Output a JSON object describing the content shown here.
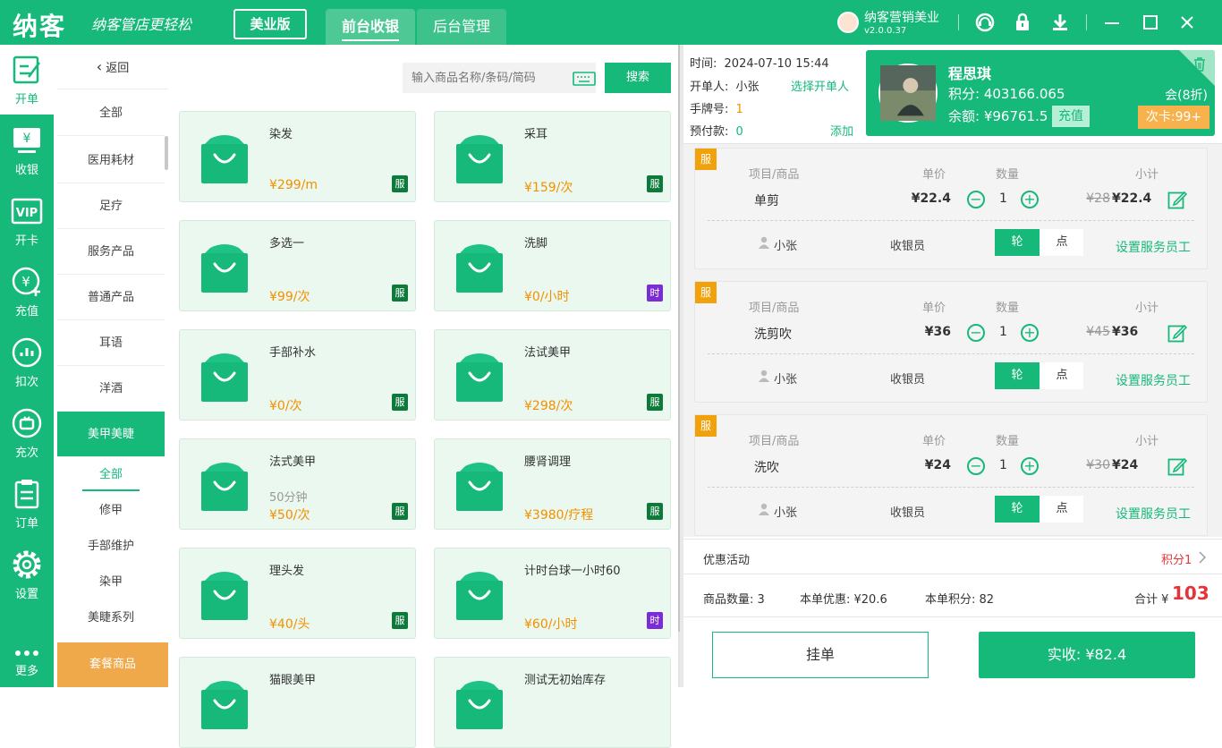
{
  "topbar": {
    "logo": "纳客",
    "slogan": "纳客管店更轻松",
    "edition": "美业版",
    "tabs": [
      {
        "label": "前台收银"
      },
      {
        "label": "后台管理"
      }
    ],
    "store_name": "纳客营销美业",
    "version": "v2.0.0.37"
  },
  "rail": [
    {
      "label": "开单",
      "icon": "edit-bill-icon"
    },
    {
      "label": "收银",
      "icon": "cashier-monitor-icon"
    },
    {
      "label": "开卡",
      "icon": "vip-card-icon"
    },
    {
      "label": "充值",
      "icon": "yen-plus-icon"
    },
    {
      "label": "扣次",
      "icon": "chart-circle-icon"
    },
    {
      "label": "充次",
      "icon": "timer-circle-icon"
    },
    {
      "label": "订单",
      "icon": "clipboard-icon"
    },
    {
      "label": "设置",
      "icon": "gear-icon"
    },
    {
      "label": "更多",
      "icon": "more-dots-icon"
    }
  ],
  "categories": {
    "back": "返回",
    "items": [
      "全部",
      "医用耗材",
      "足疗",
      "服务产品",
      "普通产品",
      "耳语",
      "洋酒",
      "美甲美睫"
    ],
    "subitems": [
      "全部",
      "修甲",
      "手部维护",
      "染甲",
      "美睫系列"
    ],
    "package": "套餐商品"
  },
  "search": {
    "placeholder": "输入商品名称/条码/简码",
    "button": "搜索"
  },
  "products": [
    {
      "name": "染发",
      "desc": "",
      "price": "¥299/m",
      "tag": "服"
    },
    {
      "name": "采耳",
      "desc": "",
      "price": "¥159/次",
      "tag": "服"
    },
    {
      "name": "多选一",
      "desc": "",
      "price": "¥99/次",
      "tag": "服"
    },
    {
      "name": "洗脚",
      "desc": "",
      "price": "¥0/小时",
      "tag": "时"
    },
    {
      "name": "手部补水",
      "desc": "",
      "price": "¥0/次",
      "tag": "服"
    },
    {
      "name": "法试美甲",
      "desc": "",
      "price": "¥298/次",
      "tag": "服"
    },
    {
      "name": "法式美甲",
      "desc": "50分钟",
      "price": "¥50/次",
      "tag": "服"
    },
    {
      "name": "腰肾调理",
      "desc": "",
      "price": "¥3980/疗程",
      "tag": "服"
    },
    {
      "name": "理头发",
      "desc": "",
      "price": "¥40/头",
      "tag": "服"
    },
    {
      "name": "计时台球一小时60",
      "desc": "",
      "price": "¥60/小时",
      "tag": "时"
    },
    {
      "name": "猫眼美甲",
      "desc": "",
      "price": "",
      "tag": ""
    },
    {
      "name": "测试无初始库存",
      "desc": "",
      "price": "",
      "tag": ""
    }
  ],
  "order_info": {
    "time_label": "时间:",
    "time_value": "2024-07-10 15:44",
    "opener_label": "开单人:",
    "opener_value": "小张",
    "select_opener": "选择开单人",
    "tag_label": "手牌号:",
    "tag_value": "1",
    "prepay_label": "预付款:",
    "prepay_value": "0",
    "add_link": "添加"
  },
  "member": {
    "name": "程思琪",
    "points": "积分: 403166.065",
    "level": "会(8折)",
    "balance": "余额: ¥96761.5",
    "recharge": "充值",
    "times_card": "次卡:99+"
  },
  "order_items": [
    {
      "badge": "服",
      "h_item": "项目/商品",
      "h_price": "单价",
      "h_qty": "数量",
      "h_sub": "小计",
      "name": "单剪",
      "price": "¥22.4",
      "qty": "1",
      "orig": "¥28",
      "subtotal": "¥22.4",
      "staff": "小张",
      "role": "收银员",
      "btn_rotate": "轮",
      "btn_point": "点",
      "set_staff": "设置服务员工"
    },
    {
      "badge": "服",
      "h_item": "项目/商品",
      "h_price": "单价",
      "h_qty": "数量",
      "h_sub": "小计",
      "name": "洗剪吹",
      "price": "¥36",
      "qty": "1",
      "orig": "¥45",
      "subtotal": "¥36",
      "staff": "小张",
      "role": "收银员",
      "btn_rotate": "轮",
      "btn_point": "点",
      "set_staff": "设置服务员工"
    },
    {
      "badge": "服",
      "h_item": "项目/商品",
      "h_price": "单价",
      "h_qty": "数量",
      "h_sub": "小计",
      "name": "洗吹",
      "price": "¥24",
      "qty": "1",
      "orig": "¥30",
      "subtotal": "¥24",
      "staff": "小张",
      "role": "收银员",
      "btn_rotate": "轮",
      "btn_point": "点",
      "set_staff": "设置服务员工"
    }
  ],
  "promo": {
    "label": "优惠活动",
    "value": "积分1"
  },
  "summary": {
    "count": "商品数量: 3",
    "discount": "本单优惠: ¥20.6",
    "points": "本单积分: 82",
    "total_label": "合计 ¥",
    "total_value": "103"
  },
  "actions": {
    "hang": "挂单",
    "pay": "实收: ¥82.4"
  },
  "colors": {
    "brand": "#16b97a",
    "orange": "#f29100",
    "service_tag": "#0d7a3b",
    "time_tag": "#7b2cd6",
    "badge": "#f0a10c"
  }
}
